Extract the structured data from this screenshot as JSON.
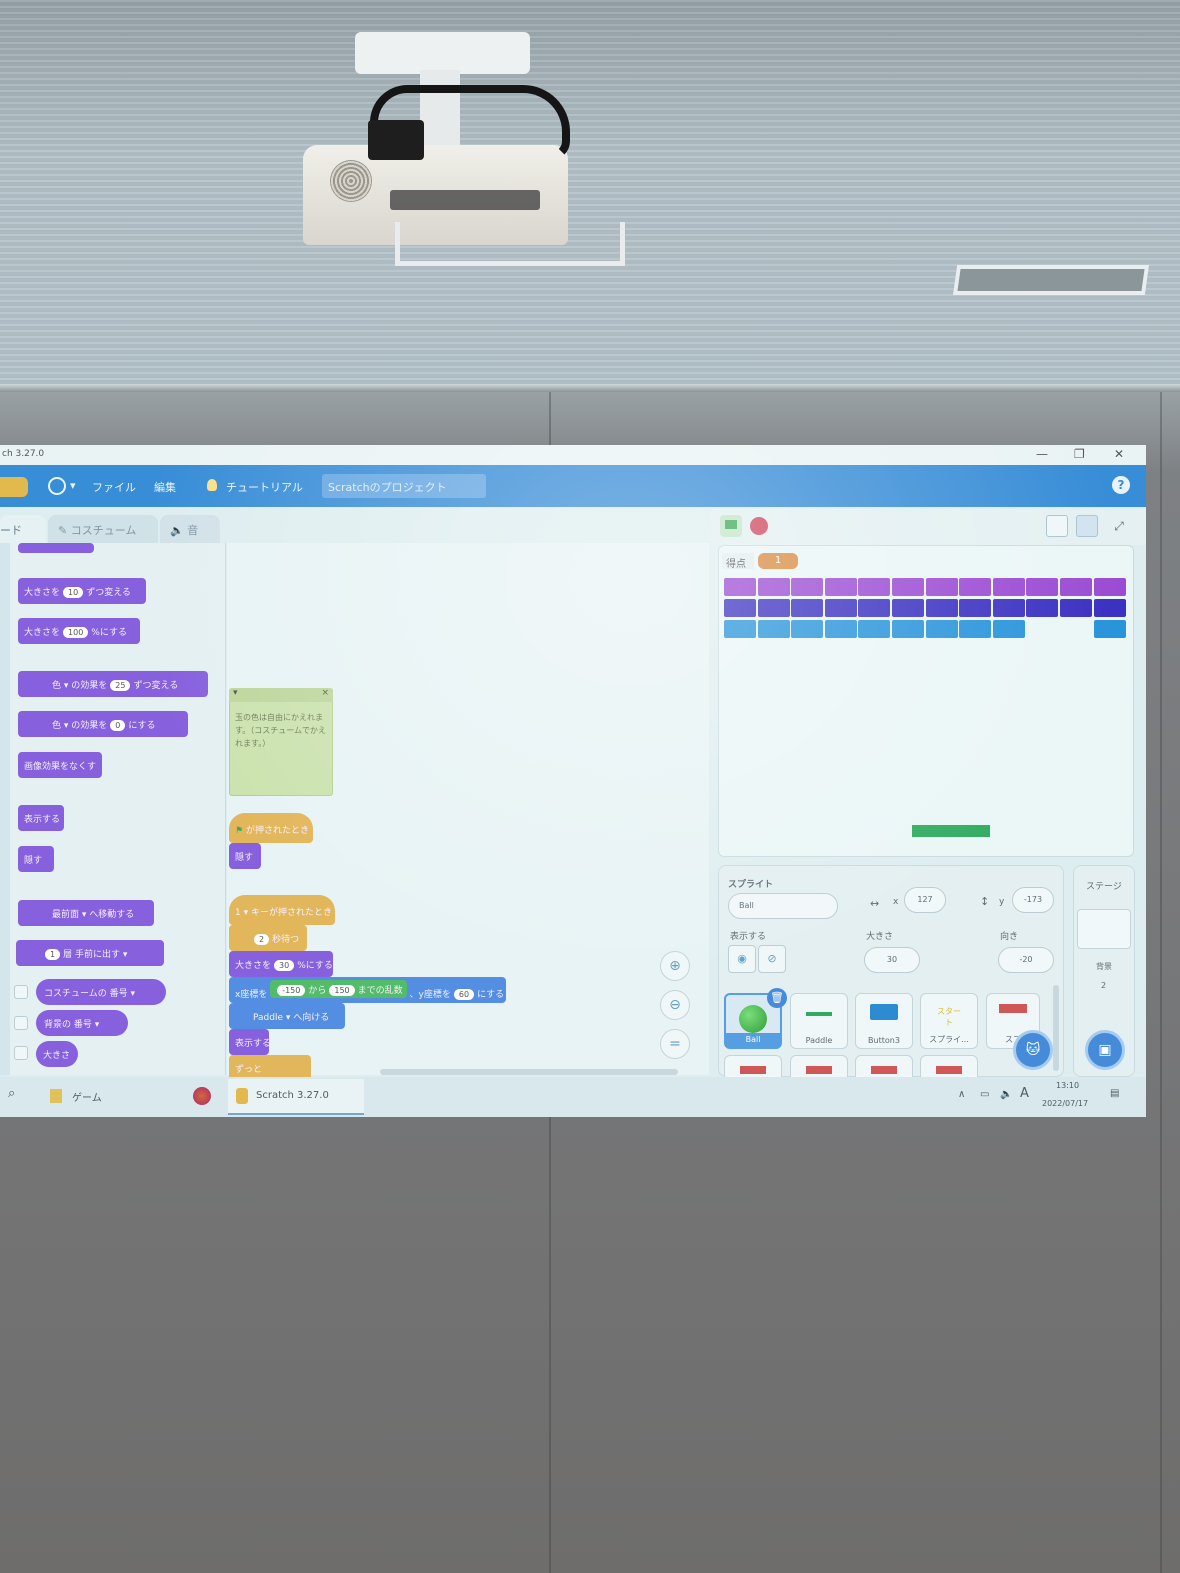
{
  "window": {
    "title": "ch 3.27.0",
    "controls": [
      "—",
      "❐",
      "✕"
    ]
  },
  "menubar": {
    "file": "ファイル",
    "edit": "編集",
    "tutorial": "チュートリアル",
    "project_title": "Scratchのプロジェクト",
    "help": "?"
  },
  "tabs": {
    "code": "ード",
    "costume": "コスチューム",
    "sound": "音"
  },
  "palette_blocks": [
    {
      "text": "大きさを",
      "value": "10",
      "suffix": "ずつ変える"
    },
    {
      "text": "大きさを",
      "value": "100",
      "suffix": "%にする"
    },
    {
      "text": "色",
      "mid": "の効果を",
      "value": "25",
      "suffix": "ずつ変える"
    },
    {
      "text": "色",
      "mid": "の効果を",
      "value": "0",
      "suffix": "にする"
    },
    {
      "text": "画像効果をなくす"
    },
    {
      "text": "表示する"
    },
    {
      "text": "隠す"
    },
    {
      "text": "最前面",
      "suffix": "へ移動する"
    },
    {
      "value": "1",
      "text": "層",
      "suffix": "手前に出す"
    },
    {
      "text": "コスチュームの",
      "suffix": "番号"
    },
    {
      "text": "背景の",
      "suffix": "番号"
    },
    {
      "text": "大きさ"
    }
  ],
  "comment": {
    "text": "玉の色は自由にかえれます。（コスチュームでかえれます。）"
  },
  "scripts": {
    "flag_hat": "が押されたとき",
    "hide": "隠す",
    "key_hat_key": "1",
    "key_hat": "キーが押されたとき",
    "wait_value": "2",
    "wait_label": "秒待つ",
    "size_label": "大きさを",
    "size_value": "30",
    "size_suffix": "%にする",
    "goto_x_label": "x座標を",
    "rand_from": "-150",
    "rand_kara": "から",
    "rand_to": "150",
    "rand_made": "までの乱数",
    "goto_y_label": "、y座標を",
    "goto_y_value": "60",
    "goto_suffix": "にする",
    "point_target": "Paddle",
    "point_suffix": "へ向ける",
    "show": "表示する",
    "forever": "ずっと"
  },
  "stage": {
    "score_label": "得点",
    "score_value": "1",
    "brick_rows": [
      {
        "color": "#a447e6",
        "count": 12
      },
      {
        "color": "#3b2fd9",
        "count": 12
      },
      {
        "color": "#1897ea",
        "count": 12,
        "missing": [
          9,
          10
        ]
      }
    ]
  },
  "sprite_info": {
    "sprite_label": "スプライト",
    "sprite_name": "Ball",
    "x_label": "x",
    "x_value": "127",
    "y_label": "y",
    "y_value": "-173",
    "show_label": "表示する",
    "size_label": "大きさ",
    "size_value": "30",
    "direction_label": "向き",
    "direction_value": "-20"
  },
  "sprites": [
    {
      "name": "Ball",
      "selected": true
    },
    {
      "name": "Paddle"
    },
    {
      "name": "Button3"
    },
    {
      "name": "スプライ..."
    },
    {
      "name": "スプ"
    }
  ],
  "stage_panel": {
    "label": "ステージ",
    "backdrop_label": "背景",
    "backdrop_count": "2"
  },
  "taskbar": {
    "search": "⌕",
    "folder_label": "ゲーム",
    "app_label": "Scratch 3.27.0",
    "ime": "A",
    "time": "13:10",
    "date": "2022/07/17"
  },
  "colors": {
    "menubar": "#2b8fe6",
    "looks_block": "#8b5df0",
    "motion_block": "#4b8ff2",
    "operator_block": "#45c15f",
    "event_block": "#e9b64a"
  }
}
